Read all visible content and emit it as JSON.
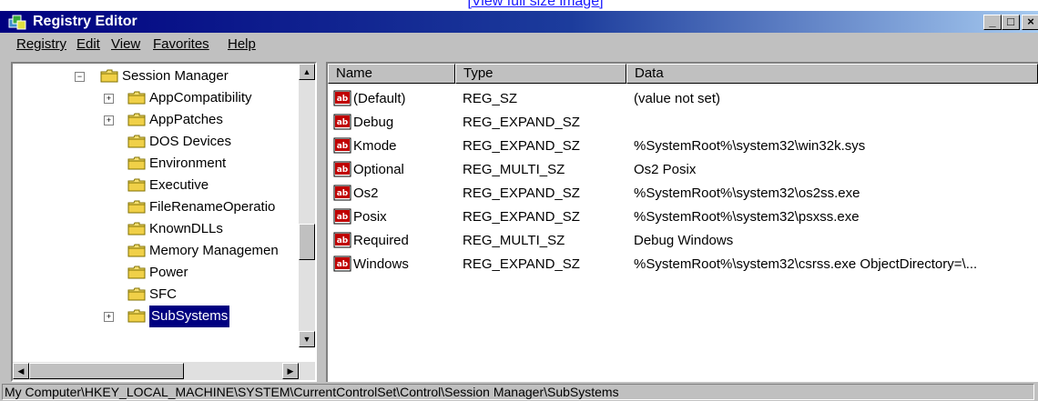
{
  "top_link": "[View full size image]",
  "window": {
    "title": "Registry Editor",
    "controls": {
      "minimize": "_",
      "maximize": "□",
      "close": "×"
    }
  },
  "menu": [
    "Registry",
    "Edit",
    "View",
    "Favorites",
    "Help"
  ],
  "tree": {
    "items": [
      {
        "label": "Session Manager",
        "expander": "−"
      },
      {
        "label": "AppCompatibility",
        "expander": "+"
      },
      {
        "label": "AppPatches",
        "expander": "+"
      },
      {
        "label": "DOS Devices",
        "expander": ""
      },
      {
        "label": "Environment",
        "expander": ""
      },
      {
        "label": "Executive",
        "expander": ""
      },
      {
        "label": "FileRenameOperatio",
        "expander": ""
      },
      {
        "label": "KnownDLLs",
        "expander": ""
      },
      {
        "label": "Memory Managemen",
        "expander": ""
      },
      {
        "label": "Power",
        "expander": ""
      },
      {
        "label": "SFC",
        "expander": ""
      },
      {
        "label": "SubSystems",
        "expander": "+",
        "selected": true
      }
    ]
  },
  "list": {
    "columns": [
      "Name",
      "Type",
      "Data"
    ],
    "rows": [
      {
        "name": "(Default)",
        "type": "REG_SZ",
        "data": "(value not set)"
      },
      {
        "name": "Debug",
        "type": "REG_EXPAND_SZ",
        "data": ""
      },
      {
        "name": "Kmode",
        "type": "REG_EXPAND_SZ",
        "data": "%SystemRoot%\\system32\\win32k.sys"
      },
      {
        "name": "Optional",
        "type": "REG_MULTI_SZ",
        "data": "Os2 Posix"
      },
      {
        "name": "Os2",
        "type": "REG_EXPAND_SZ",
        "data": "%SystemRoot%\\system32\\os2ss.exe"
      },
      {
        "name": "Posix",
        "type": "REG_EXPAND_SZ",
        "data": "%SystemRoot%\\system32\\psxss.exe"
      },
      {
        "name": "Required",
        "type": "REG_MULTI_SZ",
        "data": "Debug Windows"
      },
      {
        "name": "Windows",
        "type": "REG_EXPAND_SZ",
        "data": "%SystemRoot%\\system32\\csrss.exe ObjectDirectory=\\..."
      }
    ]
  },
  "status": "My Computer\\HKEY_LOCAL_MACHINE\\SYSTEM\\CurrentControlSet\\Control\\Session Manager\\SubSystems"
}
